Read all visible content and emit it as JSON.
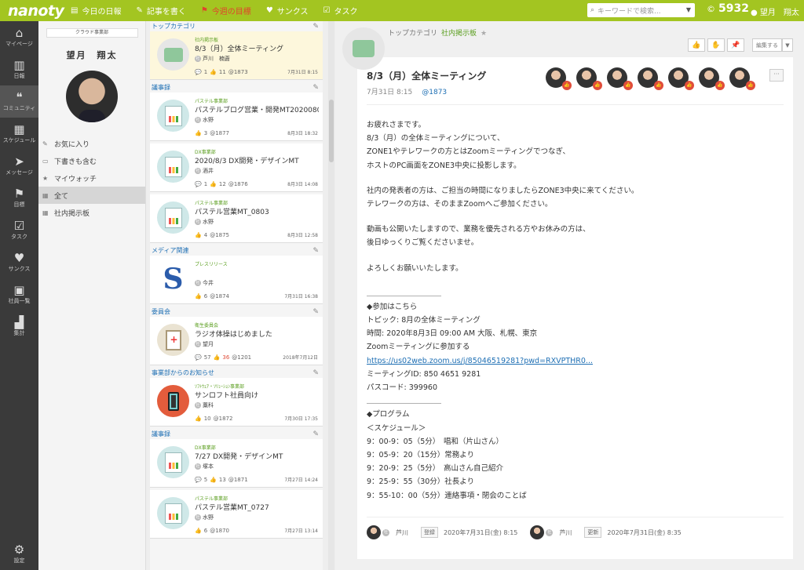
{
  "app": {
    "logo": "nanoty"
  },
  "topnav": [
    {
      "icon": "▤",
      "label": "今日の日報",
      "alert": false
    },
    {
      "icon": "✎",
      "label": "記事を書く",
      "alert": false
    },
    {
      "icon": "⚑",
      "label": "今週の目標",
      "alert": true
    },
    {
      "icon": "♥",
      "label": "サンクス",
      "alert": false
    },
    {
      "icon": "☑",
      "label": "タスク",
      "alert": false
    }
  ],
  "search": {
    "placeholder": "キーワードで検索..."
  },
  "points": "5932",
  "user": "望月　翔太",
  "leftnav": [
    {
      "icon": "⌂",
      "label": "マイページ"
    },
    {
      "icon": "▥",
      "label": "日報"
    },
    {
      "icon": "❝",
      "label": "コミュニティ"
    },
    {
      "icon": "▦",
      "label": "スケジュール"
    },
    {
      "icon": "➤",
      "label": "メッセージ"
    },
    {
      "icon": "⚑",
      "label": "目標"
    },
    {
      "icon": "☑",
      "label": "タスク"
    },
    {
      "icon": "♥",
      "label": "サンクス"
    },
    {
      "icon": "▣",
      "label": "社員一覧"
    },
    {
      "icon": "▟",
      "label": "集計"
    }
  ],
  "settings": {
    "icon": "⚙",
    "label": "設定"
  },
  "profile": {
    "dept": "クラウド事業部",
    "name": "望月　翔太"
  },
  "menu": [
    {
      "icon": "✎",
      "label": "お気に入り"
    },
    {
      "icon": "▭",
      "label": "下書きも含む"
    },
    {
      "icon": "★",
      "label": "マイウォッチ"
    },
    {
      "icon": "▦",
      "label": "全て"
    },
    {
      "icon": "▦",
      "label": "社内掲示板"
    }
  ],
  "cats": [
    "トップカテゴリ",
    "議事録",
    "メディア関連",
    "委員会",
    "事業部からのお知らせ",
    "議事録"
  ],
  "cards": [
    {
      "sub": "社内掲示板",
      "title": "8/3（月）全体ミーティング",
      "author": "芦川　楠蒼",
      "comments": "1",
      "likes": "11",
      "id": "@1873",
      "date": "7月31日 8:15"
    },
    {
      "sub": "パステル事業部",
      "title": "パステルブログ営業・開発MT20200803",
      "author": "水野",
      "likes": "3",
      "id": "@1877",
      "date": "8月3日 18:32"
    },
    {
      "sub": "DX事業部",
      "title": "2020/8/3 DX開発・デザインMT",
      "author": "酒井",
      "comments": "1",
      "likes": "12",
      "id": "@1876",
      "date": "8月3日 14:08"
    },
    {
      "sub": "パステル事業部",
      "title": "パステル営業MT_0803",
      "author": "水野",
      "likes": "4",
      "id": "@1875",
      "date": "8月3日 12:58"
    },
    {
      "sub": "プレスリリース",
      "title": "",
      "author": "今井",
      "likes": "6",
      "id": "@1874",
      "date": "7月31日 16:38"
    },
    {
      "sub": "衛生委員会",
      "title": "ラジオ体操はじめました",
      "author": "望月",
      "comments": "57",
      "likes": "36",
      "id": "@1201",
      "date": "2018年7月12日"
    },
    {
      "sub": "ｿﾌﾄｳｪｱ・ｿﾘｭｰｼｮﾝ事業部",
      "title": "サンロフト社員向け",
      "author": "藁科",
      "likes": "10",
      "id": "@1872",
      "date": "7月30日 17:35"
    },
    {
      "sub": "DX事業部",
      "title": "7/27 DX開発・デザインMT",
      "author": "塚本",
      "comments": "5",
      "likes": "13",
      "id": "@1871",
      "date": "7月27日 14:24"
    },
    {
      "sub": "パステル事業部",
      "title": "パステル営業MT_0727",
      "author": "水野",
      "likes": "6",
      "id": "@1870",
      "date": "7月27日 13:14"
    }
  ],
  "detail": {
    "crumb_root": "トップカテゴリ",
    "crumb_cur": "社内掲示板",
    "edit_label": "編集する",
    "title": "8/3（月）全体ミーティング",
    "date": "7月31日 8:15",
    "id": "@1873",
    "more": "···",
    "lines": [
      "お疲れさまです。",
      "8/3（月）の全体ミーティングについて、",
      "ZONE1やテレワークの方とはZoomミーティングでつなぎ、",
      "ホストのPC画面をZONE3中央に投影します。",
      "",
      "社内の発表者の方は、ご担当の時間になりましたらZONE3中央に来てください。",
      "テレワークの方は、そのままZoomへご参加ください。",
      "",
      "動画も公開いたしますので、業務を優先される方やお休みの方は、",
      "後日ゆっくりご覧くださいませ。",
      "",
      "よろしくお願いいたします。",
      "",
      "＿＿＿＿＿＿＿＿＿＿",
      "◆参加はこちら",
      "トピック: 8月の全体ミーティング",
      "時間: 2020年8月3日 09:00 AM 大阪、札幌、東京",
      "Zoomミーティングに参加する",
      "https://us02web.zoom.us/j/85046519281?pwd=RXVPTHR0...",
      "ミーティングID: 850 4651 9281",
      "パスコード: 399960",
      "＿＿＿＿＿＿＿＿＿＿",
      "◆プログラム",
      "＜スケジュール＞",
      "9：00-9：05（5分）　唱和（片山さん）",
      "9：05-9：20（15分）常務より",
      "9：20-9：25（5分）　高山さん自己紹介",
      "9：25-9：55（30分）社長より",
      "9：55-10：00（5分）連絡事項・閉会のことば"
    ],
    "footer": {
      "reg_name": "芦川",
      "reg_label": "登録",
      "reg_date": "2020年7月31日(金) 8:15",
      "upd_name": "芦川",
      "upd_label": "更新",
      "upd_date": "2020年7月31日(金) 8:35"
    }
  },
  "colors": {
    "brand": "#a3c521",
    "link": "#1e6fb4",
    "alert": "#e04d3a"
  }
}
